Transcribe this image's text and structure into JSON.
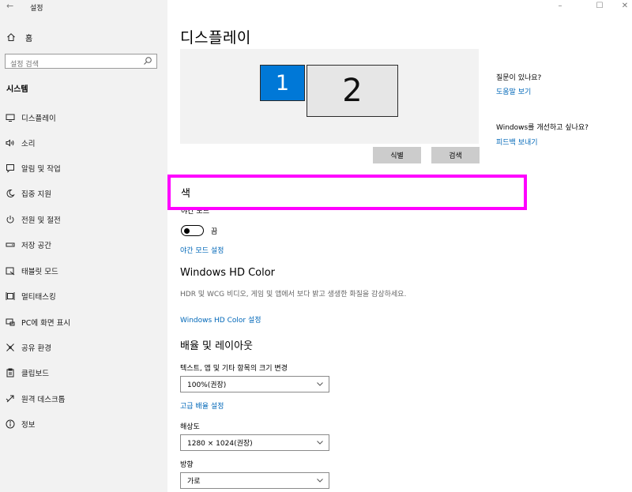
{
  "window": {
    "title": "설정",
    "back_icon": "back-arrow-icon"
  },
  "sidebar": {
    "home_label": "홈",
    "search_placeholder": "설정 검색",
    "section_title": "시스템",
    "items": [
      {
        "label": "디스플레이",
        "icon": "monitor-icon"
      },
      {
        "label": "소리",
        "icon": "speaker-icon"
      },
      {
        "label": "알림 및 작업",
        "icon": "notification-icon"
      },
      {
        "label": "집중 지원",
        "icon": "moon-icon"
      },
      {
        "label": "전원 및 절전",
        "icon": "power-icon"
      },
      {
        "label": "저장 공간",
        "icon": "storage-icon"
      },
      {
        "label": "태블릿 모드",
        "icon": "tablet-icon"
      },
      {
        "label": "멀티태스킹",
        "icon": "multitasking-icon"
      },
      {
        "label": "PC에 화면 표시",
        "icon": "project-icon"
      },
      {
        "label": "공유 환경",
        "icon": "share-icon"
      },
      {
        "label": "클립보드",
        "icon": "clipboard-icon"
      },
      {
        "label": "원격 데스크톱",
        "icon": "remote-desktop-icon"
      },
      {
        "label": "정보",
        "icon": "info-icon"
      }
    ]
  },
  "main": {
    "title": "디스플레이",
    "monitors": [
      {
        "label": "1"
      },
      {
        "label": "2"
      }
    ],
    "identify_button": "식별",
    "detect_button": "검색",
    "color_heading": "색",
    "night_mode_label": "야간 모드",
    "night_toggle_state": "끔",
    "night_settings_link": "야간 모드 설정",
    "hd_color_heading": "Windows HD Color",
    "hd_color_desc": "HDR 및 WCG 비디오, 게임 및 앱에서 보다 밝고 생생한 화질을 감상하세요.",
    "hd_color_link": "Windows HD Color 설정",
    "layout_heading": "배율 및 레이아웃",
    "scale_label": "텍스트, 앱 및 기타 항목의 크기 변경",
    "scale_value": "100%(권장)",
    "advanced_scale_link": "고급 배율 설정",
    "resolution_label": "해상도",
    "resolution_value": "1280 × 1024(권장)",
    "orientation_label": "방향",
    "orientation_value": "가로"
  },
  "help": {
    "question1": "질문이 있나요?",
    "link1": "도움말 보기",
    "question2": "Windows를 개선하고 싶나요?",
    "link2": "피드백 보내기"
  },
  "accent": {
    "link": "#0067b8",
    "monitor_selected": "#0078d7",
    "highlight_box": "#ff00ff"
  }
}
